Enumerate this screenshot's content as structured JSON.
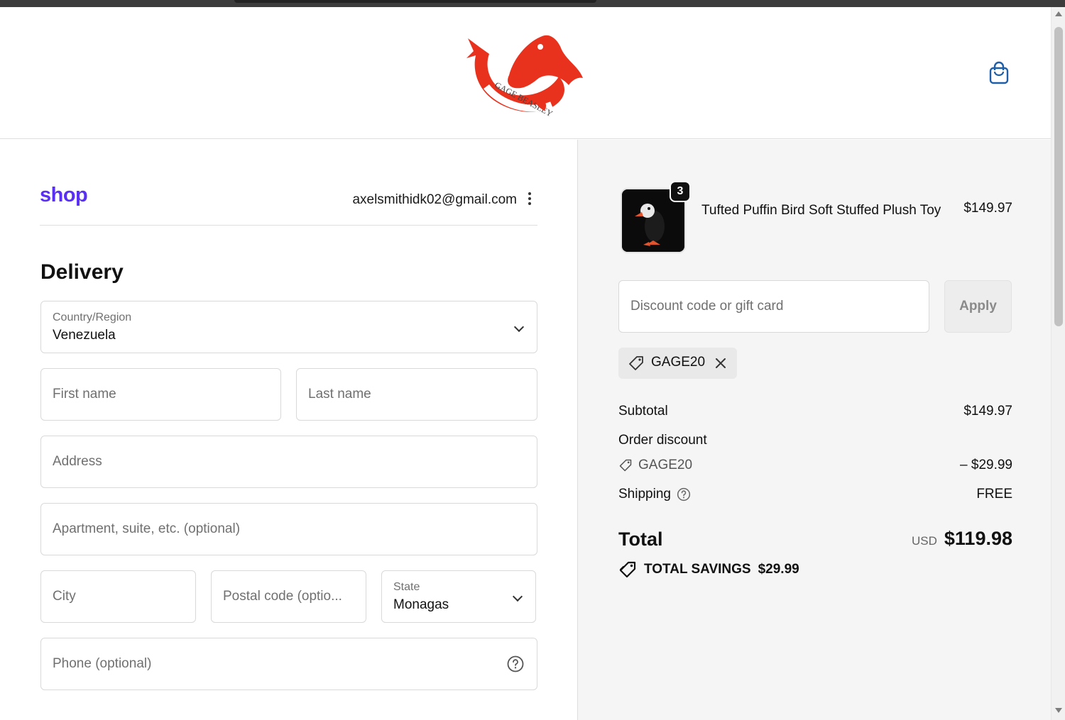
{
  "header": {
    "logo_text": "GAGE BEASLEY",
    "cart_icon": "shopping-bag-icon"
  },
  "account": {
    "shop_label": "shop",
    "email": "axelsmithidk02@gmail.com"
  },
  "delivery": {
    "heading": "Delivery",
    "country": {
      "label": "Country/Region",
      "value": "Venezuela"
    },
    "first_name": {
      "placeholder": "First name"
    },
    "last_name": {
      "placeholder": "Last name"
    },
    "address": {
      "placeholder": "Address"
    },
    "apartment": {
      "placeholder": "Apartment, suite, etc. (optional)"
    },
    "city": {
      "placeholder": "City"
    },
    "postal": {
      "placeholder": "Postal code (optio..."
    },
    "state": {
      "label": "State",
      "value": "Monagas"
    },
    "phone": {
      "placeholder": "Phone (optional)"
    }
  },
  "summary": {
    "product": {
      "name": "Tufted Puffin Bird Soft Stuffed Plush Toy",
      "price": "$149.97",
      "quantity": "3"
    },
    "discount": {
      "placeholder": "Discount code or gift card",
      "apply_label": "Apply",
      "applied_code": "GAGE20"
    },
    "subtotal_label": "Subtotal",
    "subtotal_value": "$149.97",
    "order_discount_label": "Order discount",
    "order_discount_code": "GAGE20",
    "order_discount_value": "– $29.99",
    "shipping_label": "Shipping",
    "shipping_value": "FREE",
    "total_label": "Total",
    "currency": "USD",
    "total_value": "$119.98",
    "savings_label": "TOTAL SAVINGS",
    "savings_value": "$29.99"
  },
  "colors": {
    "shop_brand": "#5a31f4",
    "logo_red": "#e8321e",
    "cart_blue": "#1f5fa8"
  }
}
